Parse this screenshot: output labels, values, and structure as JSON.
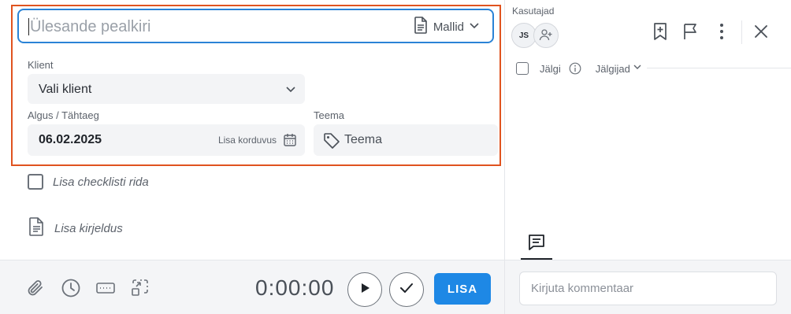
{
  "task": {
    "title_placeholder": "Ülesande pealkiri",
    "templates_label": "Mallid"
  },
  "client": {
    "label": "Klient",
    "value": "Vali klient"
  },
  "schedule": {
    "label": "Algus / Tähtaeg",
    "date": "06.02.2025",
    "recurrence_label": "Lisa korduvus"
  },
  "theme": {
    "label": "Teema",
    "value": "Teema"
  },
  "checklist": {
    "add_label": "Lisa checklisti rida"
  },
  "description": {
    "add_label": "Lisa kirjeldus"
  },
  "toolbar": {
    "timer": "0:00:00",
    "add_label": "LISA",
    "icons": [
      "paperclip-icon",
      "clock-icon",
      "keyboard-icon",
      "select-area-icon"
    ]
  },
  "sidebar": {
    "users_label": "Kasutajad",
    "avatar_initials": "JS",
    "follow_label": "Jälgi",
    "followers_label": "Jälgijad",
    "comment_placeholder": "Kirjuta kommentaar"
  },
  "colors": {
    "accent": "#1e88e5",
    "highlight_frame": "#e0531f",
    "focus_border": "#2a83d6"
  }
}
